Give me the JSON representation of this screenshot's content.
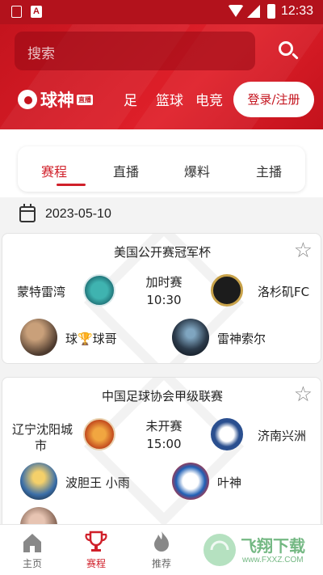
{
  "status_bar": {
    "time": "12:33",
    "notification_letter": "A"
  },
  "header": {
    "search_placeholder": "搜索",
    "logo_text": "球神",
    "logo_tag": "直播",
    "nav": [
      "足",
      "篮球",
      "电竞"
    ],
    "login_label": "登录/注册"
  },
  "tabs": [
    "赛程",
    "直播",
    "爆料",
    "主播"
  ],
  "date": "2023-05-10",
  "matches": [
    {
      "league": "美国公开赛冠军杯",
      "home": "蒙特雷湾",
      "away": "洛杉矶FC",
      "status": "加时赛",
      "time": "10:30",
      "anchors": [
        "球🏆球哥",
        "雷神索尔"
      ]
    },
    {
      "league": "中国足球协会甲级联赛",
      "home_line1": "辽宁沈阳城",
      "home_line2": "市",
      "away": "济南兴洲",
      "status": "未开赛",
      "time": "15:00",
      "anchors": [
        "波胆王 小雨",
        "叶神"
      ]
    }
  ],
  "bottom_nav": [
    "主页",
    "赛程",
    "推荐"
  ],
  "watermark": {
    "brand": "飞翔下载",
    "url": "www.FXXZ.COM"
  },
  "colors": {
    "brand_red": "#d0202a",
    "header_red": "#c4141e"
  }
}
